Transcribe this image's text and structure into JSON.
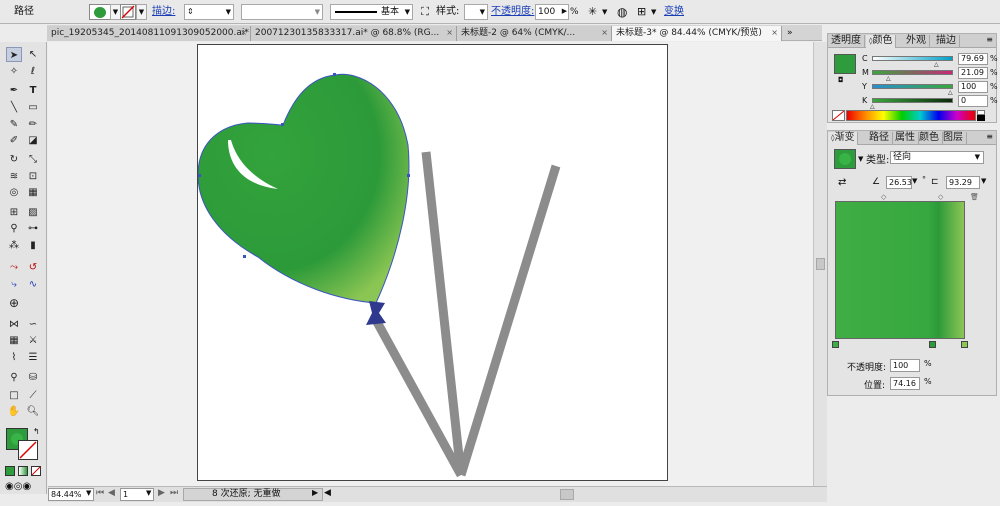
{
  "control_bar": {
    "object_type": "路径",
    "stroke_link": "描边:",
    "stroke_profile": "基本",
    "style_label": "样式:",
    "opacity_link": "不透明度:",
    "opacity_value": "100",
    "opacity_unit": "%",
    "transform_link": "变换"
  },
  "doc_tabs": [
    {
      "title": "pic_19205345_20140811091309052000.ai*",
      "active": false
    },
    {
      "title": "20071230135833317.ai* @ 68.8% (RG...",
      "active": false
    },
    {
      "title": "未标题-2 @ 64% (CMYK/...",
      "active": false
    },
    {
      "title": "未标题-3* @ 84.44% (CMYK/预览)",
      "active": true
    }
  ],
  "status_bar": {
    "zoom": "84.44%",
    "page": "1",
    "history": "8 次还原; 无重做"
  },
  "color_panel": {
    "tabs": [
      "透明度",
      "颜色",
      "外观",
      "描边"
    ],
    "active_tab": "颜色",
    "fill_color": "#2e9b3c",
    "channels": [
      {
        "label": "C",
        "value": "79.69",
        "fraction": 0.797,
        "color": "#00a0c8"
      },
      {
        "label": "M",
        "value": "21.09",
        "fraction": 0.211,
        "color": "#c8287a"
      },
      {
        "label": "Y",
        "value": "100",
        "fraction": 1.0,
        "color": "#e8d800"
      },
      {
        "label": "K",
        "value": "0",
        "fraction": 0.0,
        "color": "#222222"
      }
    ],
    "unit": "%"
  },
  "gradient_panel": {
    "tabs": [
      "渐变",
      "路径",
      "属性",
      "颜色",
      "图层"
    ],
    "active_tab": "渐变",
    "type_label": "类型:",
    "type_value": "径向",
    "angle": "26.53",
    "angle_unit": "°",
    "aspect": "93.29",
    "aspect_unit": "%",
    "gradient_start": "#3fae44",
    "gradient_mid": "#31a23b",
    "gradient_end": "#8cc655",
    "opacity_label": "不透明度:",
    "opacity_value": "100",
    "opacity_unit": "%",
    "location_label": "位置:",
    "location_value": "74.16",
    "location_unit": "%"
  },
  "artwork": {
    "balloon_color": "#2f9f3b",
    "stick_color": "#8c8c8c",
    "knot_color": "#2f3a8e"
  }
}
